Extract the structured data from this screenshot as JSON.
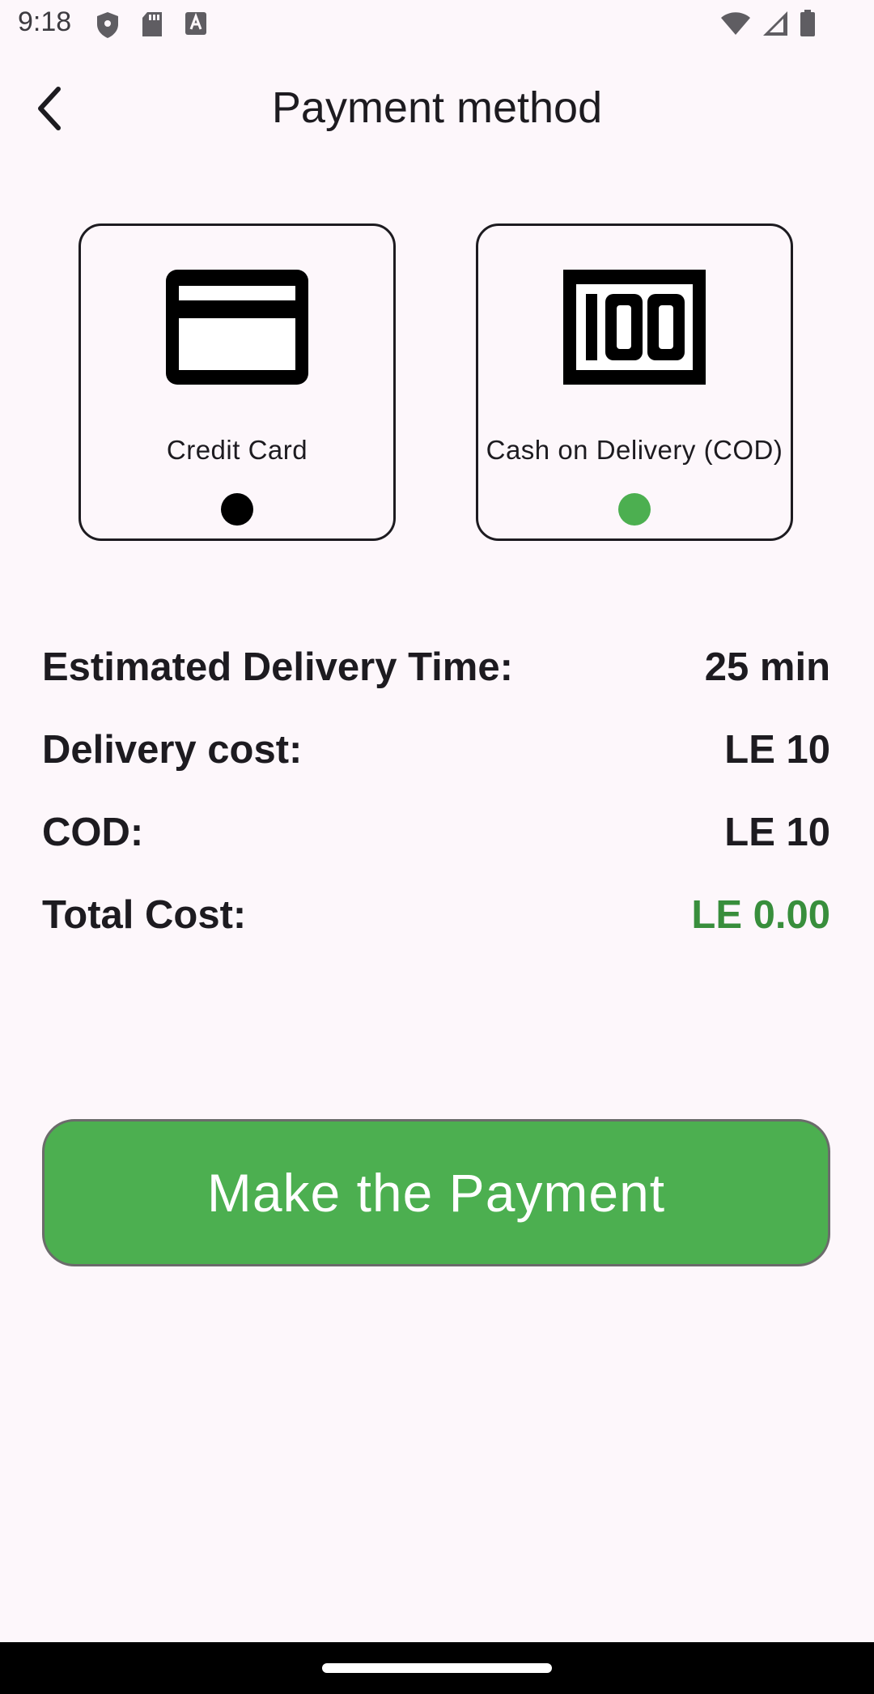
{
  "status_bar": {
    "time": "9:18",
    "icons": [
      "shield-icon",
      "sd-card-icon",
      "keyboard-a-icon",
      "wifi-icon",
      "signal-icon",
      "battery-icon"
    ]
  },
  "header": {
    "title": "Payment method",
    "back_icon": "chevron-left-icon"
  },
  "payment_methods": [
    {
      "label": "Credit Card",
      "icon": "credit-card-icon",
      "selected": false,
      "dot_color": "#000000"
    },
    {
      "label": "Cash on Delivery (COD)",
      "icon": "cash-100-icon",
      "selected": true,
      "dot_color": "#4caf50"
    }
  ],
  "summary": {
    "estimated_delivery_label": "Estimated Delivery Time:",
    "estimated_delivery_value": "25 min",
    "delivery_cost_label": "Delivery cost:",
    "delivery_cost_value": "LE 10",
    "cod_label": "COD:",
    "cod_value": "LE 10",
    "total_label": "Total Cost:",
    "total_value": "LE 0.00",
    "total_color": "#388e3c"
  },
  "actions": {
    "pay_label": "Make the Payment",
    "pay_color": "#4caf50"
  }
}
